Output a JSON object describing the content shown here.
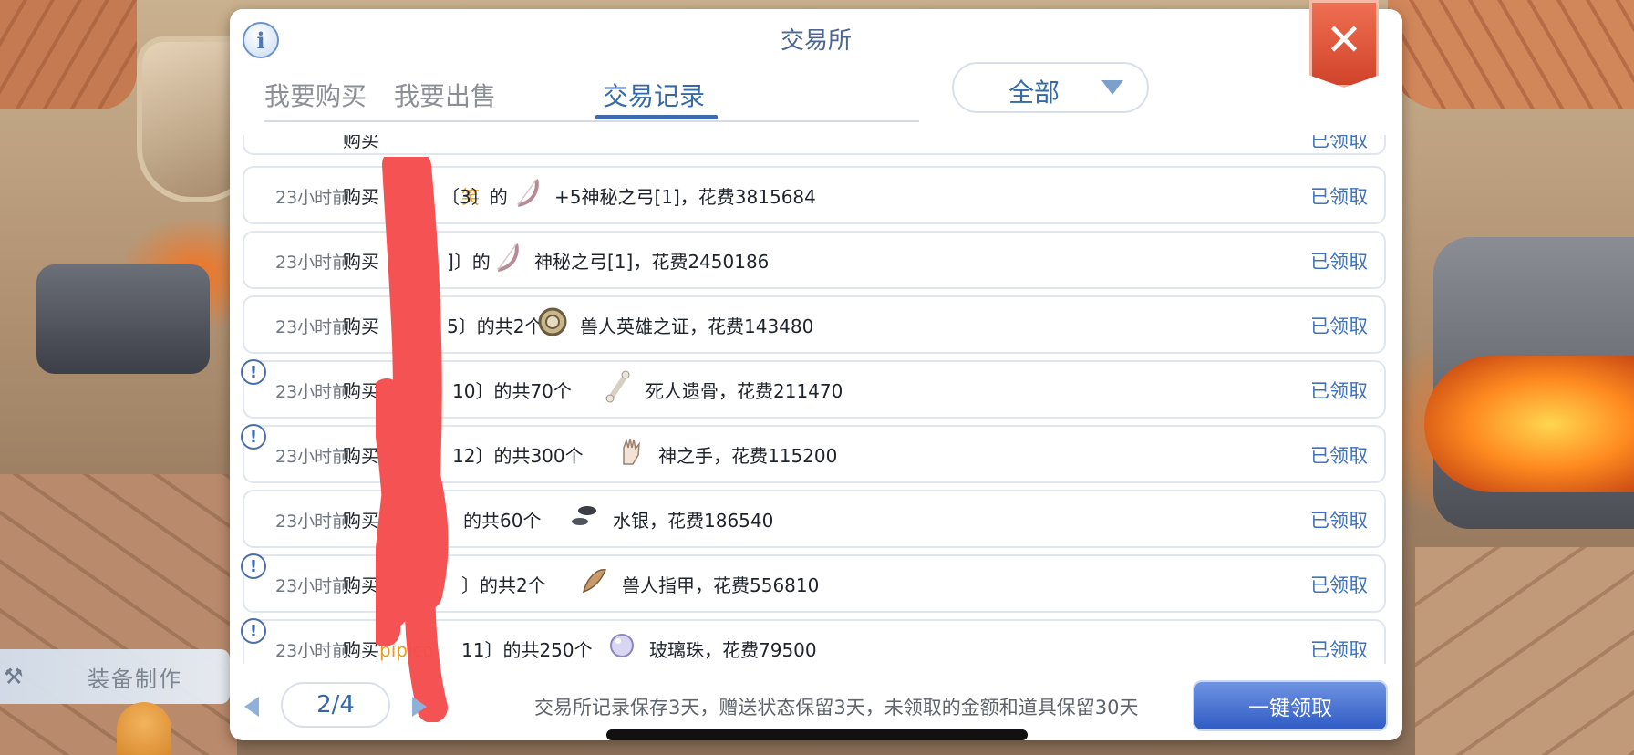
{
  "background": {
    "side_menu_label": "装备制作"
  },
  "dialog": {
    "title": "交易所",
    "tabs": [
      {
        "label": "我要购买",
        "active": false
      },
      {
        "label": "我要出售",
        "active": false
      },
      {
        "label": "交易记录",
        "active": true
      }
    ],
    "filter": {
      "selected": "全部"
    }
  },
  "records": [
    {
      "time": "",
      "verb": "购买",
      "seller": "",
      "rest": "",
      "item": "",
      "cost_text": "",
      "status": "已领取",
      "icon": "bow-icon",
      "partial": true
    },
    {
      "time": "23小时前",
      "verb": "购买",
      "seller": "笑",
      "rest": "〔3〕的",
      "item": "+5神秘之弓[1]，花费3815684",
      "status": "已领取",
      "icon": "bow-icon"
    },
    {
      "time": "23小时前",
      "verb": "购买",
      "seller": "",
      "rest": "]〕的",
      "item": "神秘之弓[1]，花费2450186",
      "status": "已领取",
      "icon": "bow-icon"
    },
    {
      "time": "23小时前",
      "verb": "购买",
      "seller": "",
      "rest": "5〕的共2个",
      "item": "兽人英雄之证，花费143480",
      "status": "已领取",
      "icon": "medal-icon"
    },
    {
      "time": "23小时前",
      "verb": "购买",
      "seller": "",
      "rest": "10〕的共70个",
      "item": "死人遗骨，花费211470",
      "status": "已领取",
      "icon": "bone-icon"
    },
    {
      "time": "23小时前",
      "verb": "购买",
      "seller": "",
      "rest": "12〕的共300个",
      "item": "神之手，花费115200",
      "status": "已领取",
      "icon": "hand-icon"
    },
    {
      "time": "23小时前",
      "verb": "购买",
      "seller": "",
      "rest": "的共60个",
      "item": "水银，花费186540",
      "status": "已领取",
      "icon": "mercury-icon"
    },
    {
      "time": "23小时前",
      "verb": "购买",
      "seller": "",
      "rest": "〕的共2个",
      "item": "兽人指甲，花费556810",
      "status": "已领取",
      "icon": "claw-icon"
    },
    {
      "time": "23小时前",
      "verb": "购买",
      "seller": "pipico",
      "rest": "11〕的共250个",
      "item": "玻璃珠，花费79500",
      "status": "已领取",
      "icon": "glass-bead-icon"
    }
  ],
  "footer": {
    "page": "2/4",
    "note": "交易所记录保存3天，赠送状态保留3天，未领取的金额和道具保留30天",
    "claim_all": "一键领取"
  },
  "colors": {
    "accent_blue": "#3569a8",
    "seller_orange": "#e89b22",
    "close_red": "#d0432a",
    "redaction_red": "#f44a4a"
  }
}
